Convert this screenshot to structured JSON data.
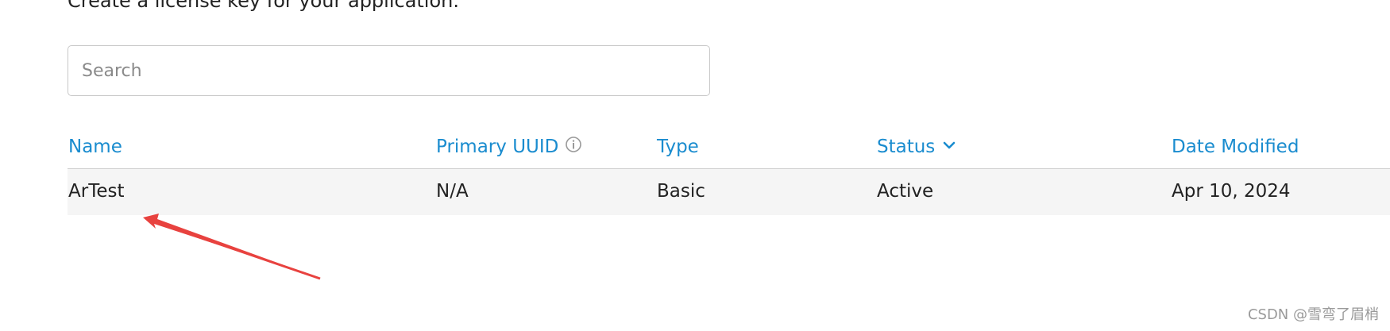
{
  "header": {
    "subtitle": "Create a license key for your application."
  },
  "search": {
    "placeholder": "Search",
    "value": ""
  },
  "table": {
    "columns": [
      {
        "label": "Name"
      },
      {
        "label": "Primary UUID",
        "icon": "info-icon"
      },
      {
        "label": "Type"
      },
      {
        "label": "Status",
        "icon": "chevron-down-icon"
      },
      {
        "label": "Date Modified"
      }
    ],
    "rows": [
      {
        "name": "ArTest",
        "primary_uuid": "N/A",
        "type": "Basic",
        "status": "Active",
        "date_modified": "Apr 10, 2024"
      }
    ]
  },
  "annotation": {
    "arrow_color": "#e8423f",
    "arrow_icon": "annotation-arrow"
  },
  "watermark": "CSDN @雪弯了眉梢",
  "colors": {
    "link_blue": "#1a8ccf",
    "row_background": "#f5f5f5",
    "text": "#222222"
  }
}
